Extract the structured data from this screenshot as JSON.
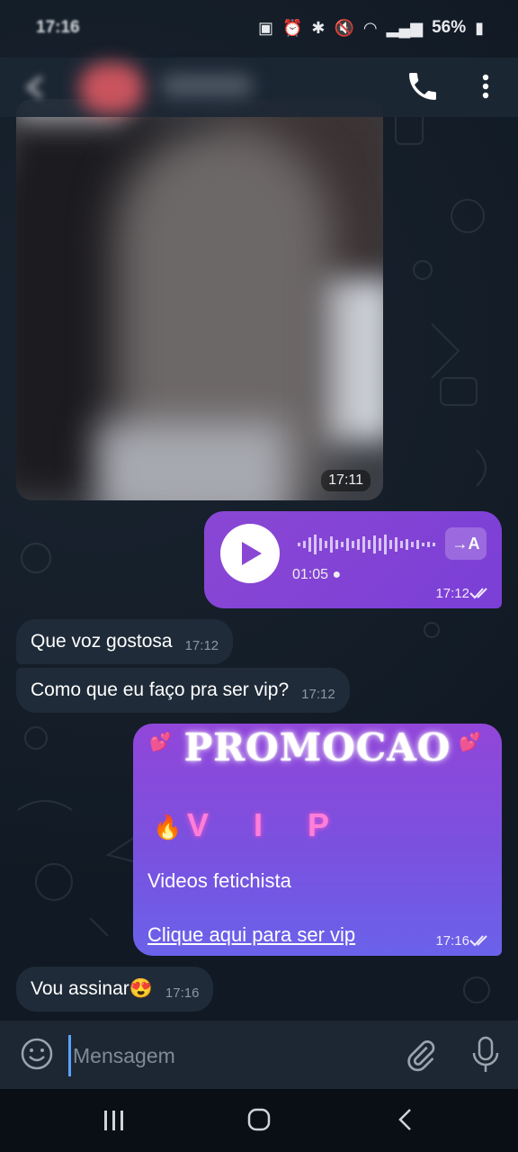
{
  "status_bar": {
    "time": "17:16",
    "battery": "56%"
  },
  "icons": {
    "call": "phone-icon",
    "more": "more-vertical-icon",
    "play": "play-icon",
    "emoji": "emoji-icon",
    "attach": "paperclip-icon",
    "mic": "microphone-icon",
    "nav_recent": "recent-apps-icon",
    "nav_home": "home-icon",
    "nav_back": "back-icon"
  },
  "colors": {
    "outgoing_bubble": "#8a47d4",
    "incoming_bubble": "#1f2b38",
    "chat_background": "#0e1621",
    "promo_vip": "#ff7fd8"
  },
  "messages": {
    "photo": {
      "time": "17:11"
    },
    "voice": {
      "duration": "01:05",
      "time": "17:12",
      "transcribe_label": "→A"
    },
    "incoming_1": {
      "text": "Que voz gostosa",
      "time": "17:12"
    },
    "incoming_2": {
      "text": "Como que eu faço pra ser vip?",
      "time": "17:12"
    },
    "promo": {
      "title": "PROMOCAO",
      "vip": "V I P",
      "line": "Videos fetichista",
      "link": "Clique aqui para ser vip",
      "time": "17:16"
    },
    "incoming_3": {
      "text": "Vou assinar😍",
      "time": "17:16"
    }
  },
  "composer": {
    "placeholder": "Mensagem"
  }
}
